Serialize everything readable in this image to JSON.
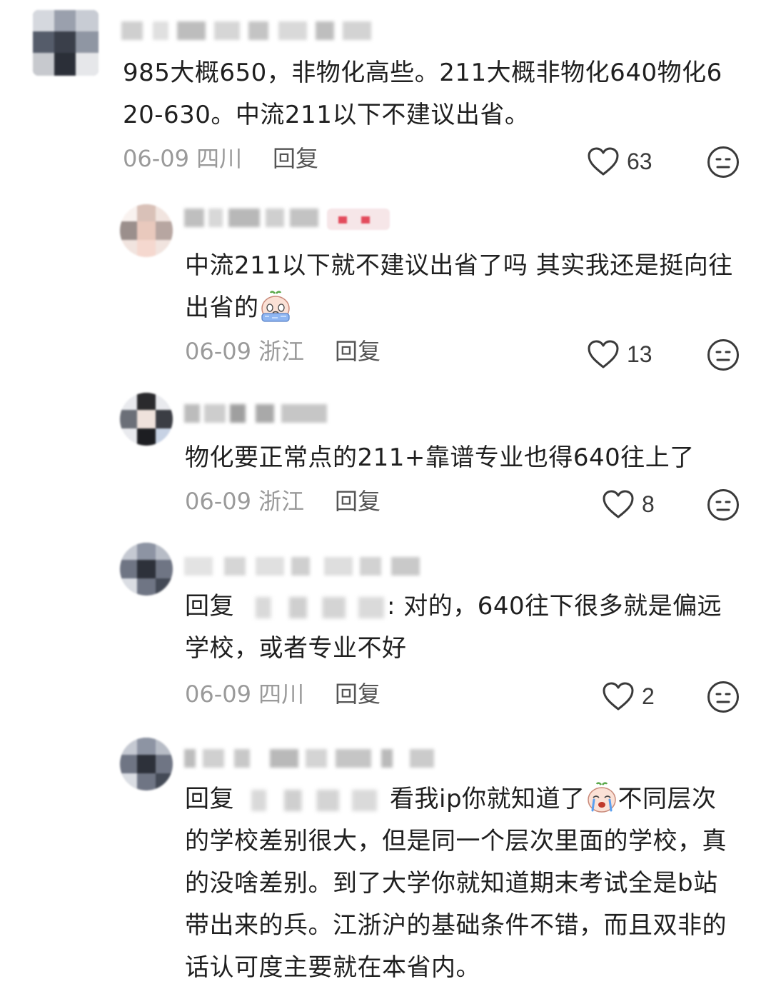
{
  "comments": [
    {
      "text": "985大概650，非物化高些。211大概非物化640物化620-630。中流211以下不建议出省。",
      "date": "06-09 四川",
      "reply_label": "回复",
      "likes": "63"
    },
    {
      "text_before": "中流211以下就不建议出省了吗 其实我还是挺向往出省的",
      "date": "06-09 浙江",
      "reply_label": "回复",
      "likes": "13",
      "emoji": "crying-face-emoji"
    },
    {
      "text": "物化要正常点的211+靠谱专业也得640往上了",
      "date": "06-09 浙江",
      "reply_label": "回复",
      "likes": "8"
    },
    {
      "reply_prefix": "回复",
      "text_after": ": 对的，640往下很多就是偏远学校，或者专业不好",
      "date": "06-09 四川",
      "reply_label": "回复",
      "likes": "2"
    },
    {
      "reply_prefix": "回复",
      "text_before": "看我ip你就知道了",
      "emoji": "crying-face-emoji",
      "text_after": "不同层次的学校差别很大，但是同一个层次里面的学校，真的没啥差别。到了大学你就知道期末考试全是b站带出来的兵。江浙沪的基础条件不错，而且双非的话认可度主要就在本省内。"
    }
  ],
  "colors": {
    "text": "#1f1f1f",
    "meta": "#9a9a9a",
    "reply": "#555555",
    "icon": "#3a3a3a"
  }
}
